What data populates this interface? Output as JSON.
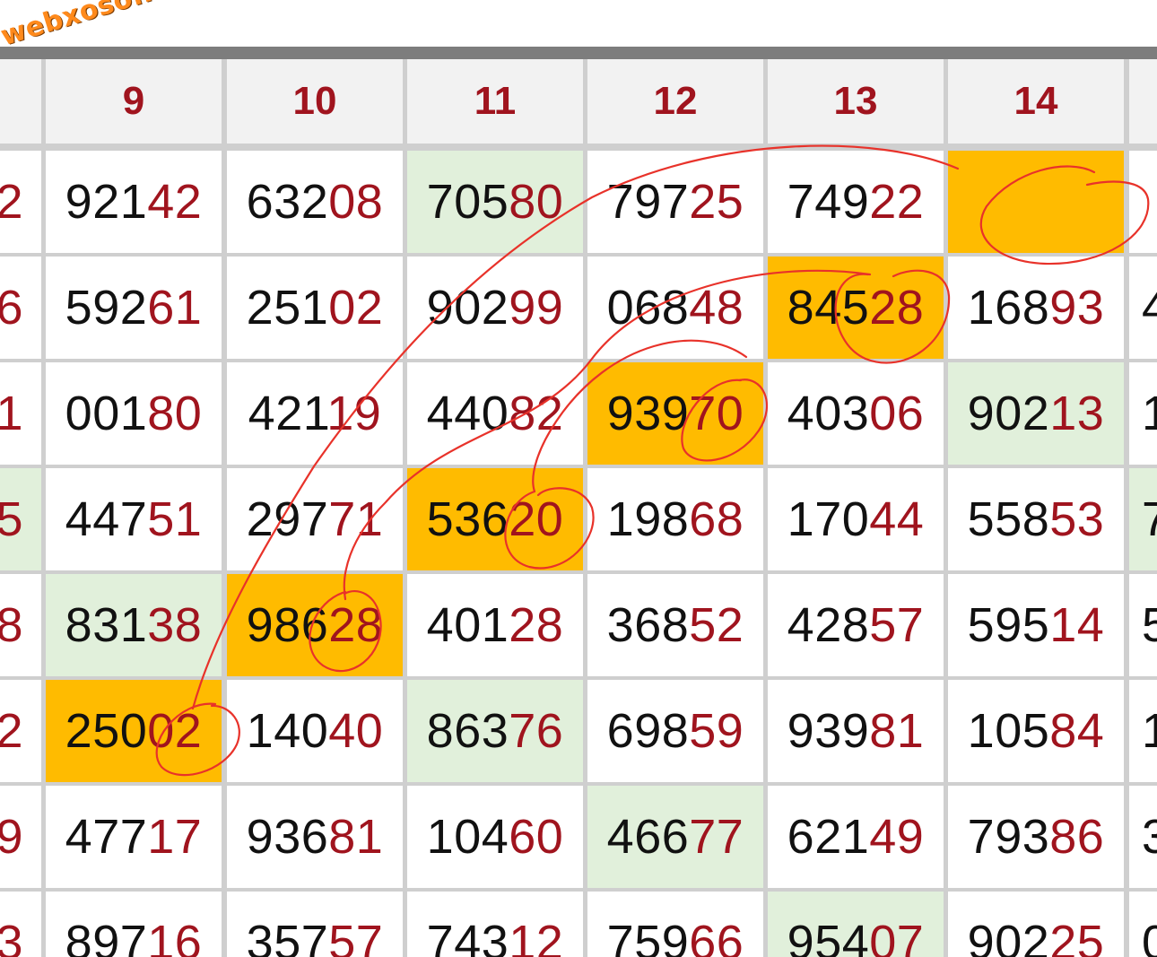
{
  "watermark": "webxoso.net",
  "headers": [
    "",
    "9",
    "10",
    "11",
    "12",
    "13",
    "14",
    ""
  ],
  "rows": [
    {
      "left": "2",
      "cells": [
        [
          "921",
          "42",
          "w"
        ],
        [
          "632",
          "08",
          "w"
        ],
        [
          "705",
          "80",
          "g"
        ],
        [
          "797",
          "25",
          "w"
        ],
        [
          "749",
          "22",
          "w"
        ],
        [
          "",
          "",
          "y"
        ]
      ],
      "right": ""
    },
    {
      "left": "6",
      "cells": [
        [
          "592",
          "61",
          "w"
        ],
        [
          "251",
          "02",
          "w"
        ],
        [
          "902",
          "99",
          "w"
        ],
        [
          "068",
          "48",
          "w"
        ],
        [
          "845",
          "28",
          "y"
        ],
        [
          "168",
          "93",
          "w"
        ]
      ],
      "right": "4"
    },
    {
      "left": "1",
      "cells": [
        [
          "001",
          "80",
          "w"
        ],
        [
          "421",
          "19",
          "w"
        ],
        [
          "440",
          "82",
          "w"
        ],
        [
          "939",
          "70",
          "y"
        ],
        [
          "403",
          "06",
          "w"
        ],
        [
          "902",
          "13",
          "g"
        ]
      ],
      "right": "1"
    },
    {
      "left": "5",
      "cells": [
        [
          "447",
          "51",
          "w"
        ],
        [
          "297",
          "71",
          "w"
        ],
        [
          "536",
          "20",
          "y"
        ],
        [
          "198",
          "68",
          "w"
        ],
        [
          "170",
          "44",
          "w"
        ],
        [
          "558",
          "53",
          "w"
        ]
      ],
      "right": "7"
    },
    {
      "left": "8",
      "cells": [
        [
          "831",
          "38",
          "g"
        ],
        [
          "986",
          "28",
          "y"
        ],
        [
          "401",
          "28",
          "w"
        ],
        [
          "368",
          "52",
          "w"
        ],
        [
          "428",
          "57",
          "w"
        ],
        [
          "595",
          "14",
          "w"
        ]
      ],
      "right": "5"
    },
    {
      "left": "2",
      "cells": [
        [
          "250",
          "02",
          "y"
        ],
        [
          "140",
          "40",
          "w"
        ],
        [
          "863",
          "76",
          "g"
        ],
        [
          "698",
          "59",
          "w"
        ],
        [
          "939",
          "81",
          "w"
        ],
        [
          "105",
          "84",
          "w"
        ]
      ],
      "right": "1"
    },
    {
      "left": "9",
      "cells": [
        [
          "477",
          "17",
          "w"
        ],
        [
          "936",
          "81",
          "w"
        ],
        [
          "104",
          "60",
          "w"
        ],
        [
          "466",
          "77",
          "g"
        ],
        [
          "621",
          "49",
          "w"
        ],
        [
          "793",
          "86",
          "w"
        ]
      ],
      "right": "3"
    },
    {
      "left": "3",
      "cells": [
        [
          "897",
          "16",
          "w"
        ],
        [
          "357",
          "57",
          "w"
        ],
        [
          "743",
          "12",
          "w"
        ],
        [
          "759",
          "66",
          "w"
        ],
        [
          "954",
          "07",
          "g"
        ],
        [
          "902",
          "25",
          "w"
        ]
      ],
      "right": "0"
    }
  ],
  "colors": {
    "highlight": "#ffbb00",
    "special": "#e1f0db",
    "tail": "#a0141e",
    "pen": "#e8322a"
  }
}
